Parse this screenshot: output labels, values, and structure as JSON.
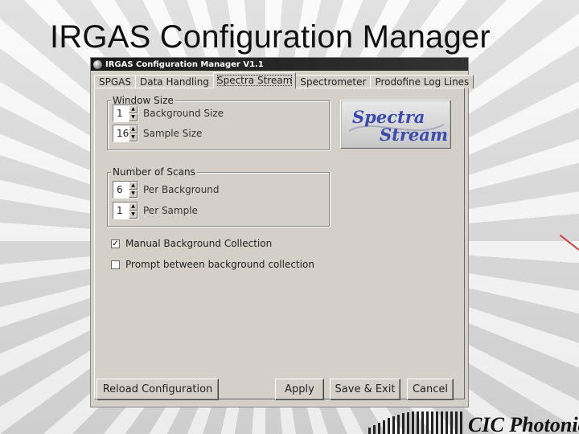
{
  "slide": {
    "title": "IRGAS Configuration Manager",
    "footer_brand": "CIC Photonics"
  },
  "window": {
    "title": "IRGAS Configuration Manager V1.1",
    "tabs": [
      {
        "label": "SPGAS",
        "active": false
      },
      {
        "label": "Data Handling",
        "active": false
      },
      {
        "label": "Spectra Stream",
        "active": true
      },
      {
        "label": "Spectrometer",
        "active": false
      },
      {
        "label": "Prodofine Log Lines",
        "active": false
      }
    ],
    "window_size": {
      "label": "Window Size",
      "background": {
        "value": "1",
        "label": "Background Size"
      },
      "sample": {
        "value": "16",
        "label": "Sample Size"
      }
    },
    "scans": {
      "label": "Number of Scans",
      "per_background": {
        "value": "6",
        "label": "Per Background"
      },
      "per_sample": {
        "value": "1",
        "label": "Per Sample"
      }
    },
    "logo": {
      "line1": "Spectra",
      "line2": "Stream"
    },
    "checks": {
      "manual": {
        "label": "Manual Background Collection",
        "checked": true
      },
      "prompt": {
        "label": "Prompt between background collection",
        "checked": false
      }
    },
    "buttons": {
      "reload": "Reload Configuration",
      "apply": "Apply",
      "save_exit": "Save & Exit",
      "cancel": "Cancel"
    }
  }
}
